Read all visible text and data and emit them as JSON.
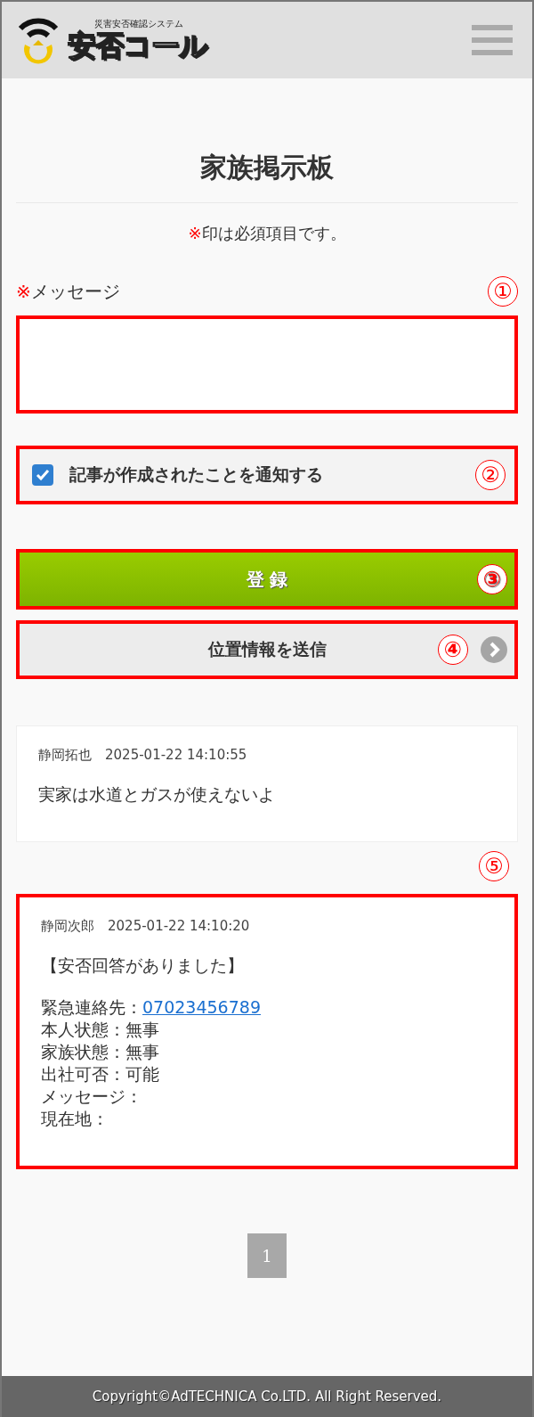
{
  "header": {
    "logo_tagline": "災害安否確認システム",
    "logo_name": "安否コール"
  },
  "page_title": "家族掲示板",
  "required_note": {
    "mark": "※",
    "text": "印は必須項目です。"
  },
  "message_field": {
    "required_mark": "※",
    "label": "メッセージ",
    "marker": "①",
    "highlighted": true
  },
  "notify_option": {
    "label": "記事が作成されたことを通知する",
    "checked": true,
    "marker": "②",
    "highlighted": true
  },
  "register_button": {
    "label": "登 録",
    "marker": "③",
    "highlighted": true
  },
  "location_button": {
    "label": "位置情報を送信",
    "marker": "④",
    "highlighted": true
  },
  "posts": [
    {
      "author": "静岡拓也",
      "time": "2025-01-22 14:10:55",
      "highlighted": false,
      "paragraphs": [
        [
          {
            "text": "実家は水道とガスが使えないよ"
          }
        ]
      ]
    },
    {
      "author": "静岡次郎",
      "time": "2025-01-22 14:10:20",
      "highlighted": true,
      "marker": "⑤",
      "paragraphs": [
        [
          {
            "text": "【安否回答がありました】"
          }
        ],
        [
          {
            "text": "緊急連絡先：",
            "link": "07023456789"
          },
          {
            "text": "本人状態：無事"
          },
          {
            "text": "家族状態：無事"
          },
          {
            "text": "出社可否：可能"
          },
          {
            "text": "メッセージ："
          },
          {
            "text": "現在地："
          }
        ]
      ]
    }
  ],
  "pagination": [
    {
      "label": "1",
      "selected": true
    }
  ],
  "footer": {
    "copyright": "Copyright©AdTECHNICA Co.LTD. All Right Reserved."
  }
}
